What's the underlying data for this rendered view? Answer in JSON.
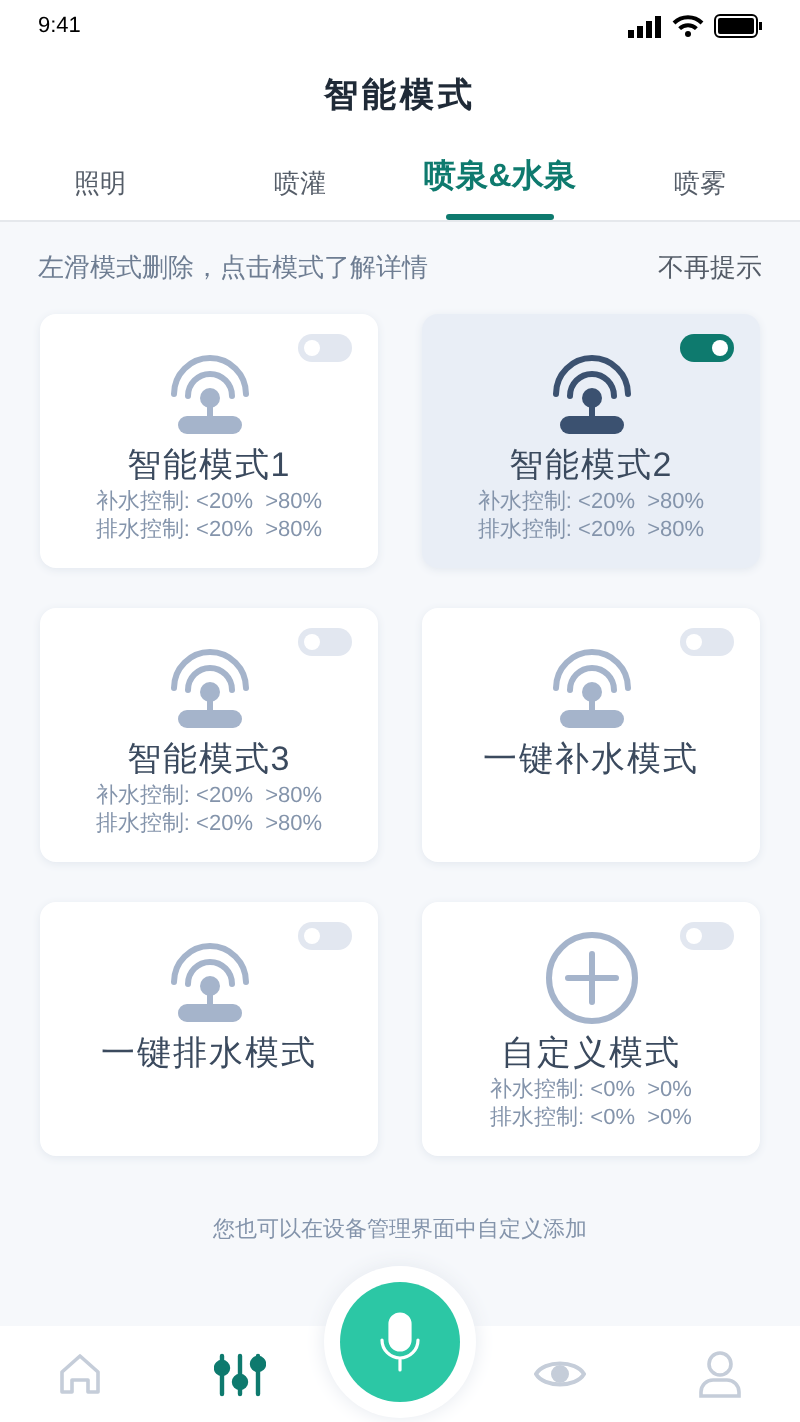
{
  "status_bar": {
    "time": "9:41"
  },
  "title": "智能模式",
  "tabs": [
    {
      "label": "照明",
      "selected": false
    },
    {
      "label": "喷灌",
      "selected": false
    },
    {
      "label": "喷泉&水泉",
      "selected": true
    },
    {
      "label": "喷雾",
      "selected": false
    }
  ],
  "hint": {
    "text": "左滑模式删除，点击模式了解详情",
    "dismiss": "不再提示"
  },
  "modes": [
    {
      "kind": "fountain",
      "name": "智能模式1",
      "on": false,
      "lines": [
        {
          "label": "补水控制:",
          "low": "<20%",
          "high": ">80%"
        },
        {
          "label": "排水控制:",
          "low": "<20%",
          "high": ">80%"
        }
      ]
    },
    {
      "kind": "fountain",
      "name": "智能模式2",
      "on": true,
      "lines": [
        {
          "label": "补水控制:",
          "low": "<20%",
          "high": ">80%"
        },
        {
          "label": "排水控制:",
          "low": "<20%",
          "high": ">80%"
        }
      ]
    },
    {
      "kind": "fountain",
      "name": "智能模式3",
      "on": false,
      "lines": [
        {
          "label": "补水控制:",
          "low": "<20%",
          "high": ">80%"
        },
        {
          "label": "排水控制:",
          "low": "<20%",
          "high": ">80%"
        }
      ]
    },
    {
      "kind": "fountain",
      "name": "一键补水模式",
      "on": false
    },
    {
      "kind": "fountain",
      "name": "一键排水模式",
      "on": false
    },
    {
      "kind": "add",
      "name": "自定义模式",
      "on": false,
      "lines": [
        {
          "label": "补水控制:",
          "low": "<0%",
          "high": ">0%"
        },
        {
          "label": "排水控制:",
          "low": "<0%",
          "high": ">0%"
        }
      ]
    }
  ],
  "footer_note": "您也可以在设备管理界面中自定义添加",
  "nav": [
    {
      "kind": "home",
      "selected": false
    },
    {
      "kind": "sliders",
      "selected": true
    },
    {
      "kind": "mic",
      "selected": false
    },
    {
      "kind": "eye",
      "selected": false
    },
    {
      "kind": "user",
      "selected": false
    }
  ]
}
